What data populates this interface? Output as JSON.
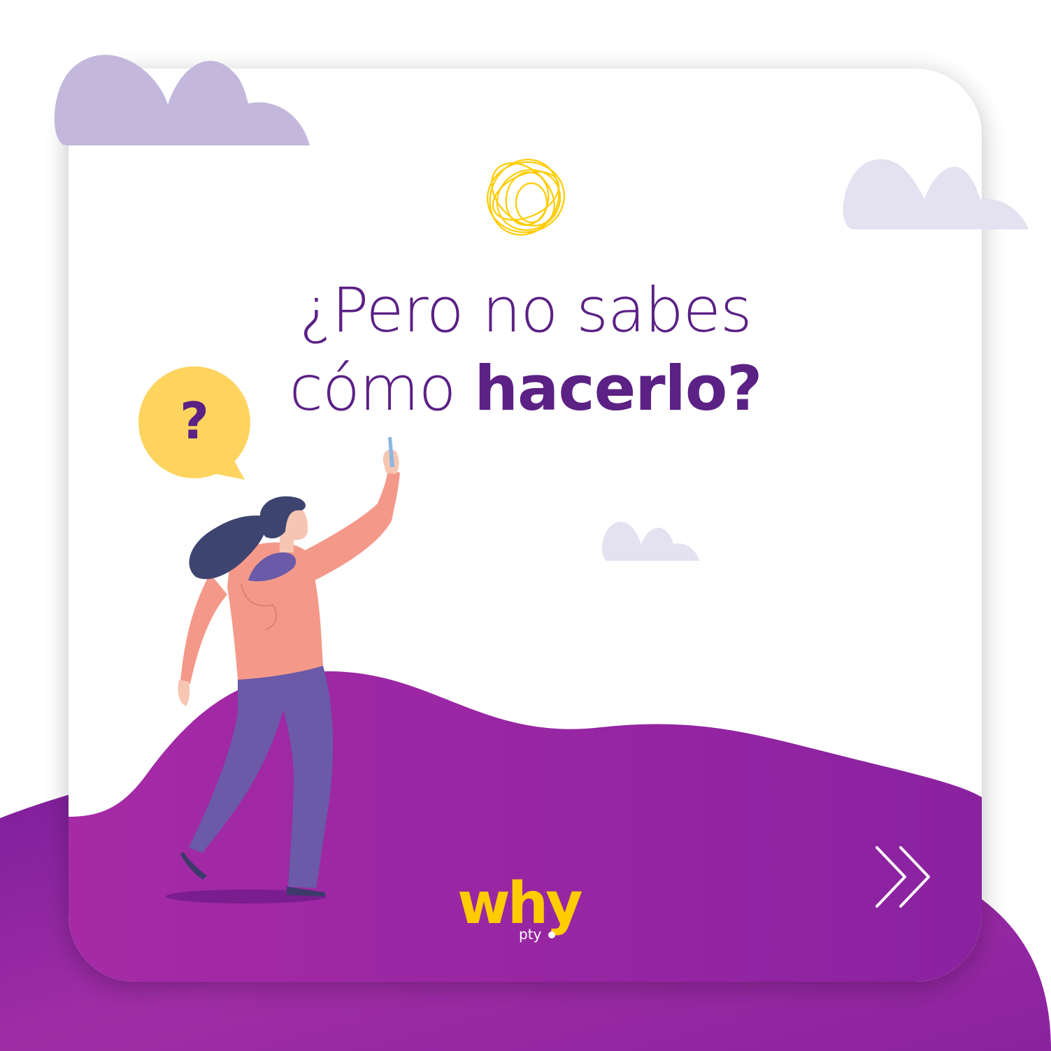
{
  "headline": {
    "line1": "¿Pero no sabes",
    "line2_regular": "cómo ",
    "line2_bold": "hacerlo?"
  },
  "speech_bubble": {
    "text": "?"
  },
  "logo": {
    "main": "why",
    "sub": "pty"
  },
  "icons": {
    "scribble": "scribble-icon",
    "next": "double-chevron-right-icon",
    "question": "question-bubble-icon"
  },
  "colors": {
    "purple_dark": "#5b2185",
    "purple_bg": "#8b22a0",
    "cloud_lilac": "#c3b8dc",
    "cloud_pale": "#e4e1f0",
    "yellow": "#ffcc00",
    "bubble_yellow": "#fed45f"
  }
}
